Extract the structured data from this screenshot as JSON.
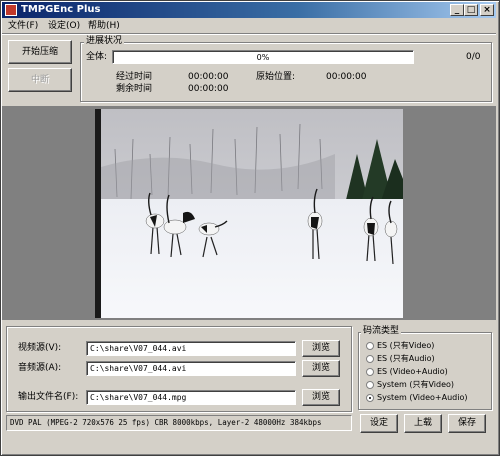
{
  "window": {
    "title": "TMPGEnc Plus",
    "minimize": "_",
    "maximize": "□",
    "close": "×"
  },
  "menu": [
    "文件(F)",
    "设定(O)",
    "帮助(H)"
  ],
  "controls": {
    "start_label": "开始压缩",
    "stop_label": "中断"
  },
  "progress": {
    "group_title": "进展状况",
    "overall_label": "全体:",
    "percent_text": "0%",
    "percent_value": 0,
    "count": "0/0",
    "elapsed_label": "经过时间",
    "elapsed_value": "00:00:00",
    "remaining_label": "剩余时间",
    "remaining_value": "00:00:00",
    "origin_label": "原始位置:",
    "origin_value": "00:00:00"
  },
  "files": {
    "video_label": "视频源(V):",
    "video_value": "C:\\share\\V07_044.avi",
    "audio_label": "音频源(A):",
    "audio_value": "C:\\share\\V07_044.avi",
    "output_label": "输出文件名(F):",
    "output_value": "C:\\share\\V07_044.mpg",
    "browse_label": "浏览"
  },
  "stream_type": {
    "title": "码流类型",
    "options": [
      "ES (只有Video)",
      "ES (只有Audio)",
      "ES (Video+Audio)",
      "System (只有Video)",
      "System (Video+Audio)"
    ],
    "selected_index": 4
  },
  "status_text": "DVD PAL (MPEG-2 720x576 25 fps) CBR 8000kbps,  Layer-2 48000Hz 384kbps",
  "buttons": {
    "settings": "设定",
    "load": "上载",
    "save": "保存"
  }
}
